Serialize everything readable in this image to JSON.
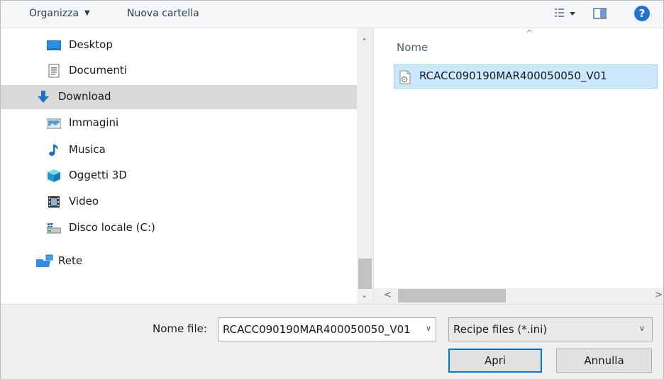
{
  "toolbar": {
    "organize_label": "Organizza",
    "new_folder_label": "Nuova cartella",
    "help_label": "?"
  },
  "nav": {
    "items": [
      {
        "label": "Desktop",
        "icon": "desktop-icon"
      },
      {
        "label": "Documenti",
        "icon": "documents-icon"
      },
      {
        "label": "Download",
        "icon": "download-icon",
        "selected": true
      },
      {
        "label": "Immagini",
        "icon": "pictures-icon"
      },
      {
        "label": "Musica",
        "icon": "music-icon"
      },
      {
        "label": "Oggetti 3D",
        "icon": "3d-objects-icon"
      },
      {
        "label": "Video",
        "icon": "video-icon"
      },
      {
        "label": "Disco locale (C:)",
        "icon": "local-disk-icon"
      },
      {
        "label": "Rete",
        "icon": "network-icon"
      }
    ]
  },
  "files": {
    "column_name": "Nome",
    "items": [
      {
        "name": "RCACC090190MAR400050050_V01",
        "icon": "settings-file-icon",
        "selected": true
      }
    ]
  },
  "footer": {
    "file_name_label": "Nome file:",
    "file_name_value": "RCACC090190MAR400050050_V01",
    "file_type_value": "Recipe files (*.ini)",
    "open_label": "Apri",
    "cancel_label": "Annulla"
  },
  "colors": {
    "selection": "#cce8ff",
    "nav_selected": "#d9d9d9",
    "accent": "#0078d7",
    "help": "#1f74d1"
  }
}
